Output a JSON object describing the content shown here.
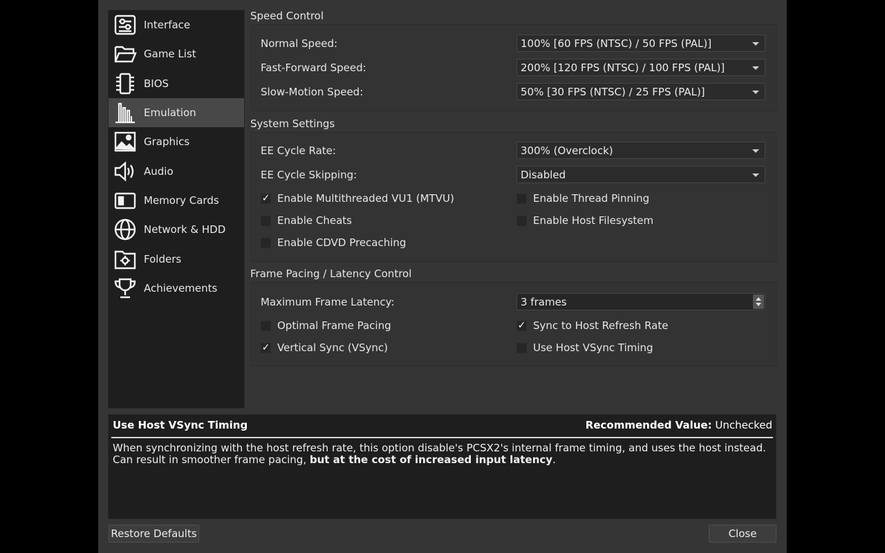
{
  "sidebar": {
    "items": [
      {
        "label": "Interface",
        "icon": "interface-icon"
      },
      {
        "label": "Game List",
        "icon": "folder-open-icon"
      },
      {
        "label": "BIOS",
        "icon": "chip-icon"
      },
      {
        "label": "Emulation",
        "icon": "emulation-icon"
      },
      {
        "label": "Graphics",
        "icon": "image-icon"
      },
      {
        "label": "Audio",
        "icon": "speaker-icon"
      },
      {
        "label": "Memory Cards",
        "icon": "memory-card-icon"
      },
      {
        "label": "Network & HDD",
        "icon": "globe-icon"
      },
      {
        "label": "Folders",
        "icon": "folder-gear-icon"
      },
      {
        "label": "Achievements",
        "icon": "trophy-icon"
      }
    ],
    "active": "Emulation"
  },
  "speed": {
    "title": "Speed Control",
    "normal_label": "Normal Speed:",
    "normal_value": "100% [60 FPS (NTSC) / 50 FPS (PAL)]",
    "ff_label": "Fast-Forward Speed:",
    "ff_value": "200% [120 FPS (NTSC) / 100 FPS (PAL)]",
    "slow_label": "Slow-Motion Speed:",
    "slow_value": "50% [30 FPS (NTSC) / 25 FPS (PAL)]"
  },
  "system": {
    "title": "System Settings",
    "ee_rate_label": "EE Cycle Rate:",
    "ee_rate_value": "300% (Overclock)",
    "ee_skip_label": "EE Cycle Skipping:",
    "ee_skip_value": "Disabled",
    "mtvu": "Enable Multithreaded VU1 (MTVU)",
    "thread_pinning": "Enable Thread Pinning",
    "cheats": "Enable Cheats",
    "host_fs": "Enable Host Filesystem",
    "cdvd": "Enable CDVD Precaching",
    "check_mark": "✓"
  },
  "framepacing": {
    "title": "Frame Pacing / Latency Control",
    "max_latency_label": "Maximum Frame Latency:",
    "max_latency_value": "3 frames",
    "optimal": "Optimal Frame Pacing",
    "sync_host": "Sync to Host Refresh Rate",
    "vsync": "Vertical Sync (VSync)",
    "host_vsync": "Use Host VSync Timing"
  },
  "description": {
    "title": "Use Host VSync Timing",
    "recommended_label": "Recommended Value:",
    "recommended_value": "Unchecked",
    "text_normal": "When synchronizing with the host refresh rate, this option disable's PCSX2's internal frame timing, and uses the host instead. Can result in smoother frame pacing, ",
    "text_bold": "but at the cost of increased input latency",
    "text_end": "."
  },
  "buttons": {
    "restore": "Restore Defaults",
    "close": "Close"
  }
}
